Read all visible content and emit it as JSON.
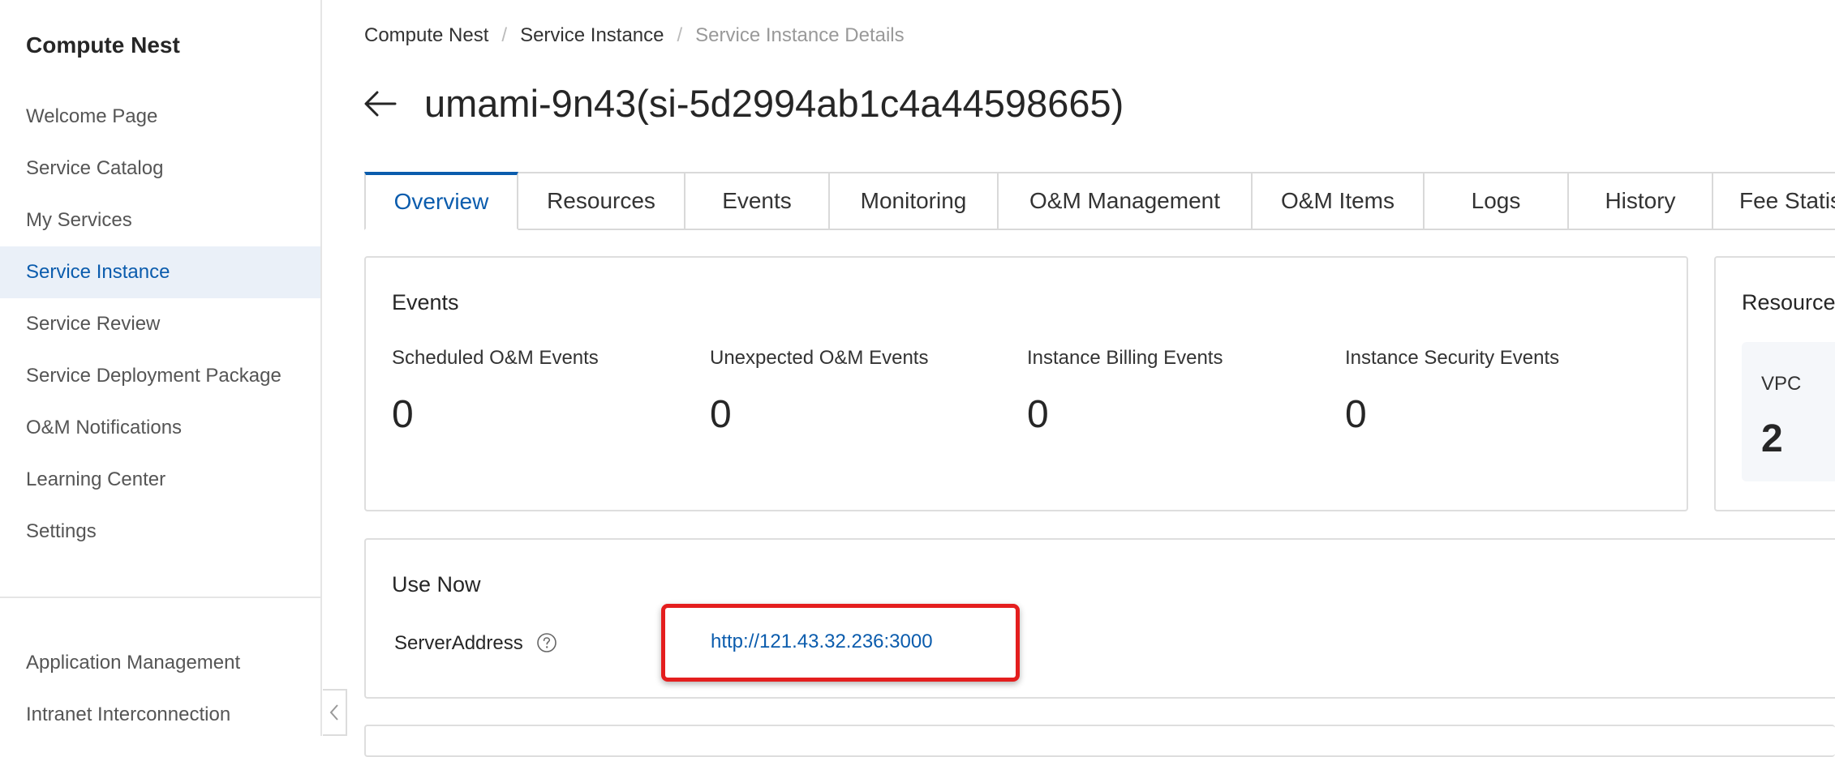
{
  "sidebar": {
    "product_title": "Compute Nest",
    "items": [
      {
        "label": "Welcome Page"
      },
      {
        "label": "Service Catalog"
      },
      {
        "label": "My Services"
      },
      {
        "label": "Service Instance"
      },
      {
        "label": "Service Review"
      },
      {
        "label": "Service Deployment Package"
      },
      {
        "label": "O&M Notifications"
      },
      {
        "label": "Learning Center"
      },
      {
        "label": "Settings"
      }
    ],
    "bottom_items": [
      {
        "label": "Application Management"
      },
      {
        "label": "Intranet Interconnection"
      }
    ],
    "active_item": "Service Instance",
    "collapse_icon": "chevron-left-icon"
  },
  "breadcrumb": {
    "items": [
      "Compute Nest",
      "Service Instance",
      "Service Instance Details"
    ],
    "separator": "/"
  },
  "header": {
    "back_icon": "arrow-left-icon",
    "title": "umami-9n43(si-5d2994ab1c4a44598665)"
  },
  "tabs": [
    {
      "label": "Overview",
      "active": true
    },
    {
      "label": "Resources"
    },
    {
      "label": "Events"
    },
    {
      "label": "Monitoring"
    },
    {
      "label": "O&M Management"
    },
    {
      "label": "O&M Items"
    },
    {
      "label": "Logs"
    },
    {
      "label": "History"
    },
    {
      "label": "Fee Statis"
    }
  ],
  "events_card": {
    "title": "Events",
    "stats": [
      {
        "label": "Scheduled O&M Events",
        "value": "0"
      },
      {
        "label": "Unexpected O&M Events",
        "value": "0"
      },
      {
        "label": "Instance Billing Events",
        "value": "0"
      },
      {
        "label": "Instance Security Events",
        "value": "0"
      }
    ]
  },
  "resources_card": {
    "title": "Resource",
    "items": [
      {
        "label": "VPC",
        "value": "2"
      }
    ]
  },
  "use_now_card": {
    "title": "Use Now",
    "server_address_label": "ServerAddress",
    "help_icon": "question-circle-icon",
    "server_address": "http://121.43.32.236:3000"
  },
  "colors": {
    "accent": "#0b5cad",
    "highlight": "#e41e1e",
    "active_nav_bg": "#eaf0f8"
  }
}
